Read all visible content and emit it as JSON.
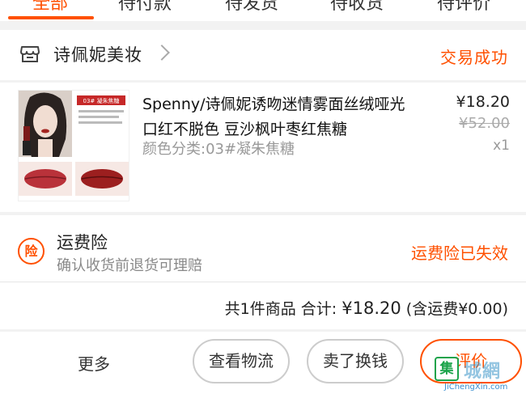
{
  "tabs": [
    {
      "label": "全部",
      "active": true
    },
    {
      "label": "待付款"
    },
    {
      "label": "待发货"
    },
    {
      "label": "待收货"
    },
    {
      "label": "待评价"
    }
  ],
  "shop": {
    "name": "诗佩妮美妆",
    "status": "交易成功",
    "icon": "store-icon"
  },
  "product": {
    "title": "Spenny/诗佩妮诱吻迷情雾面丝绒哑光口红不脱色 豆沙枫叶枣红焦糖",
    "sku": "颜色分类:03#凝朱焦糖",
    "price": "¥18.20",
    "original_price": "¥52.00",
    "quantity": "x1",
    "thumb_label": "03# 凝朱焦糖"
  },
  "insurance": {
    "icon_text": "险",
    "title": "运费险",
    "description": "确认收货前退货可理赔",
    "status": "运费险已失效"
  },
  "summary": {
    "count_text": "共1件商品",
    "total_label": "合计:",
    "total": "¥18.20",
    "shipping_note": "(含运费¥0.00)"
  },
  "actions": {
    "more": "更多",
    "logistics": "查看物流",
    "resell": "卖了换钱",
    "review": "评价"
  },
  "watermark": {
    "badge": "集",
    "text": "城網",
    "url": "JiChengXin.com"
  },
  "colors": {
    "accent": "#ff5000",
    "watermark_green": "#1ba34a"
  }
}
